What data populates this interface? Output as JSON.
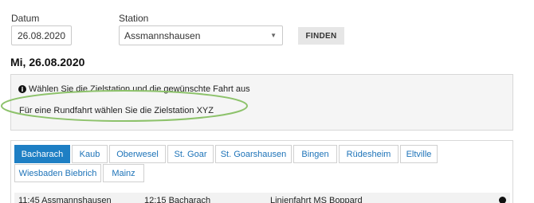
{
  "form": {
    "date_label": "Datum",
    "date_value": "26.08.2020",
    "station_label": "Station",
    "station_value": "Assmannshausen",
    "find_button": "FINDEN"
  },
  "day_heading": "Mi, 26.08.2020",
  "info": {
    "icon": "info-icon",
    "line1": "Wählen Sie die Zielstation und die gewünschte Fahrt aus",
    "line2": "Für eine Rundfahrt wählen Sie die Zielstation XYZ"
  },
  "annotation_color": "#8dc26b",
  "accent_color": "#1e7fc4",
  "tabs": [
    {
      "label": "Bacharach",
      "active": true
    },
    {
      "label": "Kaub"
    },
    {
      "label": "Oberwesel"
    },
    {
      "label": "St. Goar"
    },
    {
      "label": "St. Goarshausen"
    },
    {
      "label": "Bingen"
    },
    {
      "label": "Rüdesheim"
    },
    {
      "label": "Eltville"
    },
    {
      "label": "Wiesbaden Biebrich"
    },
    {
      "label": "Mainz"
    }
  ],
  "trip_row": {
    "departure": "11:45 Assmannshausen",
    "arrival": "12:15 Bacharach",
    "line": "Linienfahrt MS Boppard"
  }
}
